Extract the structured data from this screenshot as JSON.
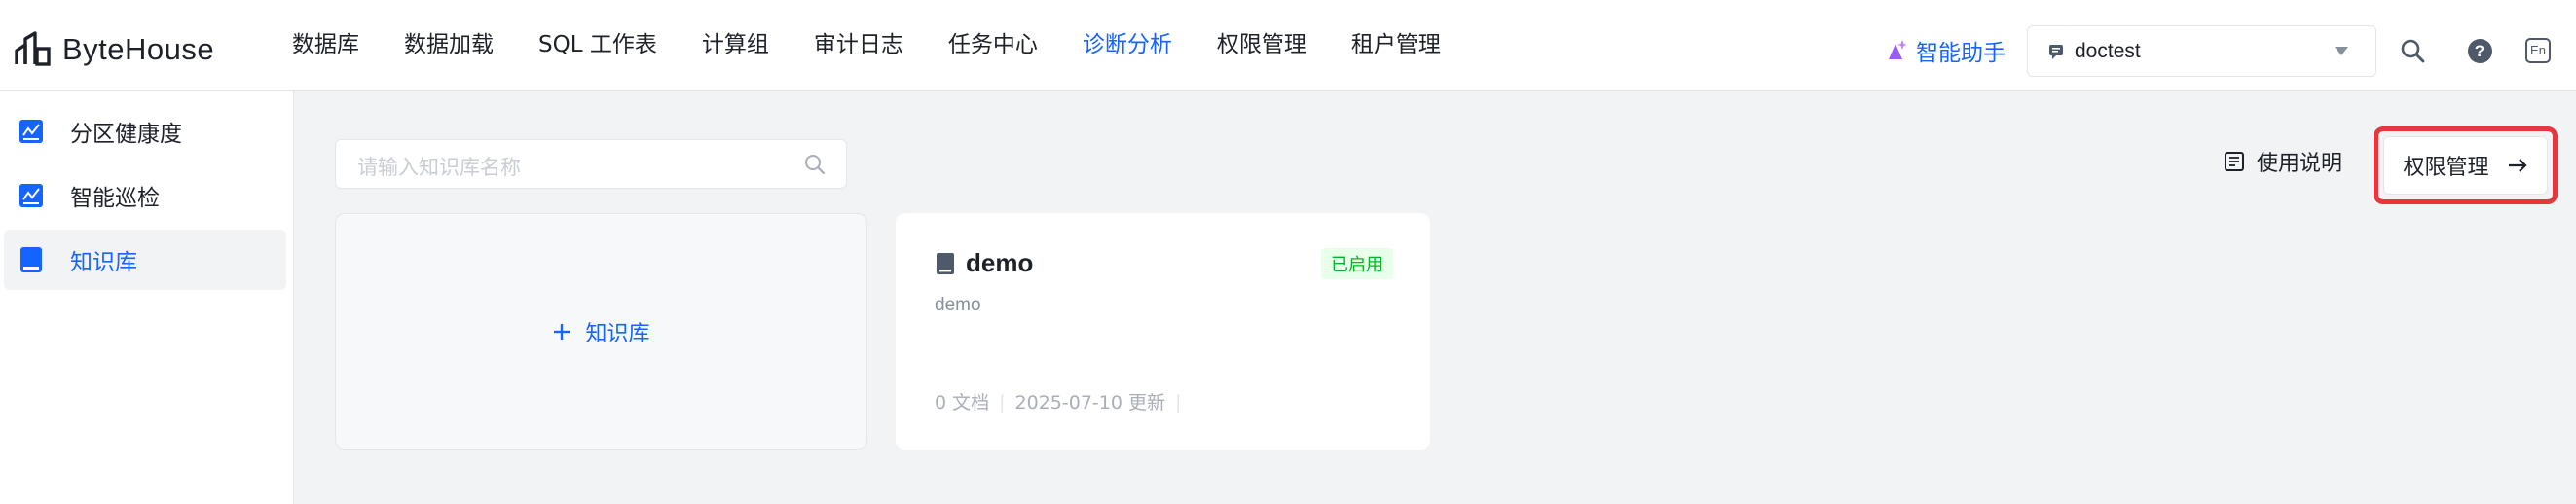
{
  "app": {
    "logo_text": "ByteHouse"
  },
  "nav": {
    "items": [
      {
        "label": "数据库",
        "active": false
      },
      {
        "label": "数据加载",
        "active": false
      },
      {
        "label": "SQL 工作表",
        "active": false
      },
      {
        "label": "计算组",
        "active": false
      },
      {
        "label": "审计日志",
        "active": false
      },
      {
        "label": "任务中心",
        "active": false
      },
      {
        "label": "诊断分析",
        "active": true
      },
      {
        "label": "权限管理",
        "active": false
      },
      {
        "label": "租户管理",
        "active": false
      }
    ],
    "assistant_label": "智能助手",
    "workspace_value": "doctest",
    "lang_label": "En",
    "help_label": "?"
  },
  "sidebar": {
    "items": [
      {
        "label": "分区健康度",
        "icon": "chart-icon",
        "active": false
      },
      {
        "label": "智能巡检",
        "icon": "chart-icon",
        "active": false
      },
      {
        "label": "知识库",
        "icon": "book-icon",
        "active": true
      }
    ]
  },
  "toolbar": {
    "search_placeholder": "请输入知识库名称",
    "guide_label": "使用说明",
    "permission_label": "权限管理"
  },
  "cards": {
    "new_label": "知识库",
    "kb": {
      "title": "demo",
      "status": "已启用",
      "description": "demo",
      "doc_count": "0 文档",
      "updated": "2025-07-10 更新"
    }
  },
  "colors": {
    "accent": "#1664ff",
    "highlight_outline": "#e8363f",
    "status_green": "#00b42a"
  }
}
